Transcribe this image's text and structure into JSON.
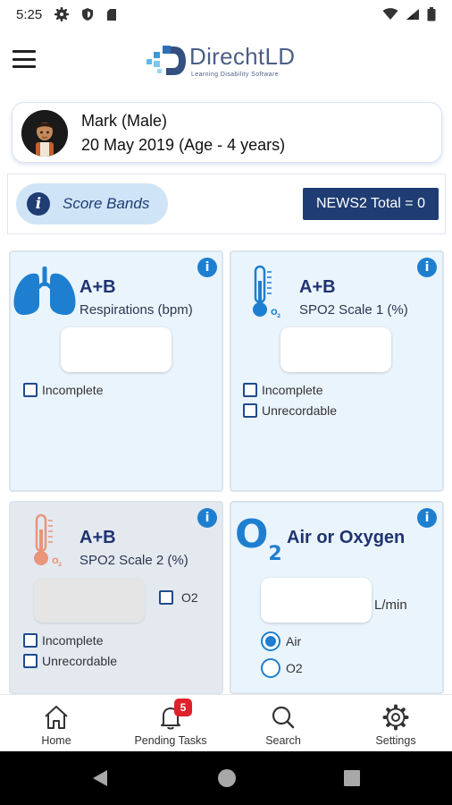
{
  "status_bar": {
    "time": "5:25"
  },
  "app": {
    "logo_title": "DirechtLD",
    "logo_subtitle": "Learning Disability Software"
  },
  "patient": {
    "name": "Mark (Male)",
    "dob": "20 May 2019 (Age - 4 years)"
  },
  "score": {
    "bands_label": "Score Bands",
    "news2_total": "NEWS2 Total = 0"
  },
  "panels": {
    "respirations": {
      "title": "A+B",
      "subtitle": "Respirations (bpm)",
      "value": "",
      "checkboxes": [
        {
          "label": "Incomplete",
          "checked": false
        }
      ]
    },
    "spo2_scale1": {
      "title": "A+B",
      "subtitle": "SPO2 Scale 1 (%)",
      "value": "",
      "checkboxes": [
        {
          "label": "Incomplete",
          "checked": false
        },
        {
          "label": "Unrecordable",
          "checked": false
        }
      ]
    },
    "spo2_scale2": {
      "title": "A+B",
      "subtitle": "SPO2 Scale 2 (%)",
      "value": "",
      "o2_label": "O2",
      "checkboxes": [
        {
          "label": "Incomplete",
          "checked": false
        },
        {
          "label": "Unrecordable",
          "checked": false
        }
      ]
    },
    "air_oxygen": {
      "title": "Air or Oxygen",
      "value": "",
      "unit": "L/min",
      "options": [
        {
          "label": "Air",
          "selected": true
        },
        {
          "label": "O2",
          "selected": false
        }
      ]
    }
  },
  "bottom_nav": {
    "items": [
      {
        "label": "Home"
      },
      {
        "label": "Pending Tasks",
        "badge": "5"
      },
      {
        "label": "Search"
      },
      {
        "label": "Settings"
      }
    ]
  },
  "colors": {
    "navy": "#1f3d73",
    "accent_blue": "#1e7fd0",
    "panel_bg": "#eaf4fd",
    "badge_red": "#e0202a"
  }
}
